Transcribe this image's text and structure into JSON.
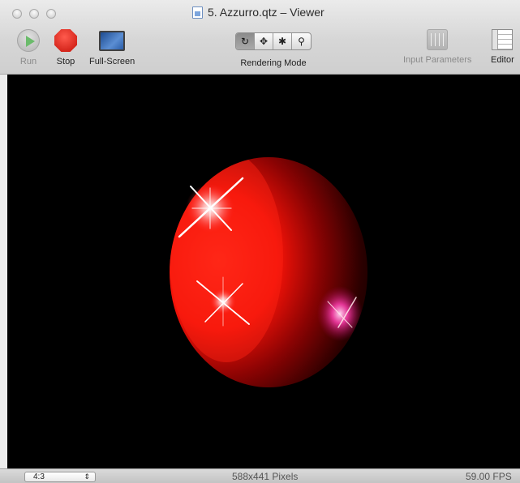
{
  "window": {
    "title": "5. Azzurro.qtz – Viewer",
    "controls": [
      "close",
      "minimize",
      "zoom"
    ]
  },
  "toolbar": {
    "run": {
      "label": "Run",
      "icon": "play-icon",
      "enabled": false
    },
    "stop": {
      "label": "Stop",
      "icon": "stop-icon"
    },
    "full_screen": {
      "label": "Full-Screen",
      "icon": "full-screen-icon"
    },
    "rendering_mode": {
      "label": "Rendering Mode",
      "buttons": [
        {
          "icon": "rotate-icon",
          "glyph": "↻",
          "active": true
        },
        {
          "icon": "move-icon",
          "glyph": "✥",
          "active": false
        },
        {
          "icon": "bug-icon",
          "glyph": "✱",
          "active": false
        },
        {
          "icon": "zoom-icon",
          "glyph": "⚲",
          "active": false
        }
      ]
    },
    "input_parameters": {
      "label": "Input Parameters",
      "icon": "sliders-icon",
      "enabled": false
    },
    "editor": {
      "label": "Editor",
      "icon": "editor-icon"
    }
  },
  "viewer": {
    "background": "#000000",
    "content": "glowing-red-sphere",
    "colors": {
      "sphere": "#ff1a10",
      "highlight": "#ffffff",
      "flare": "#ff3fb0"
    }
  },
  "statusbar": {
    "aspect_ratio": "4:3",
    "size": "588x441 Pixels",
    "fps": "59.00 FPS"
  }
}
